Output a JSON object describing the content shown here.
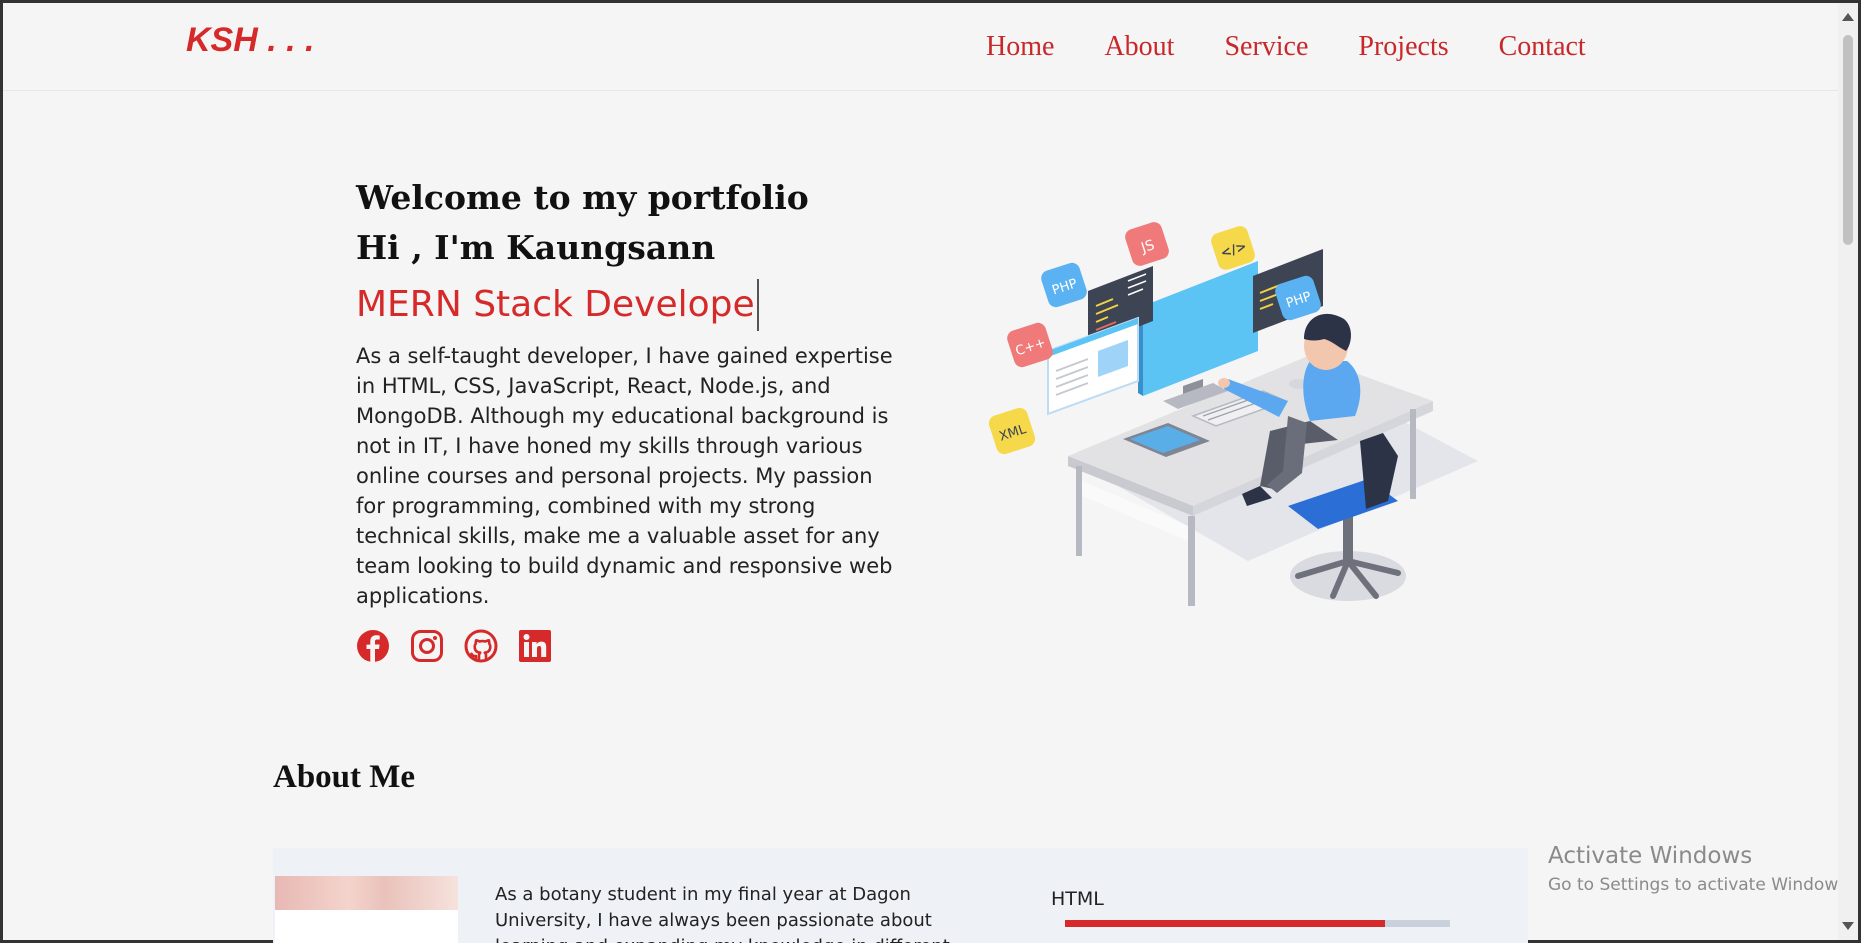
{
  "header": {
    "logo": "KSH . . .",
    "nav": [
      "Home",
      "About",
      "Service",
      "Projects",
      "Contact"
    ]
  },
  "hero": {
    "welcome": "Welcome to my portfolio",
    "greeting": "Hi , I'm Kaungsann",
    "role": "MERN Stack Develope",
    "bio": "As a self-taught developer, I have gained expertise in HTML, CSS, JavaScript, React, Node.js, and MongoDB. Although my educational background is not in IT, I have honed my skills through various online courses and personal projects. My passion for programming, combined with my strong technical skills, make me a valuable asset for any team looking to build dynamic and responsive web applications.",
    "socials": [
      "facebook-icon",
      "instagram-icon",
      "github-icon",
      "linkedin-icon"
    ],
    "illustration_labels": [
      "JS",
      "</>",
      "PHP",
      "PHP",
      "C++",
      "XML"
    ]
  },
  "about": {
    "title": "About Me",
    "text": "As a botany student in my final year at Dagon University, I have always been passionate about learning and expanding my knowledge in different areas. Recently, I",
    "skills": [
      {
        "name": "HTML",
        "level": 0.83
      }
    ]
  },
  "os_overlay": {
    "line1": "Activate Windows",
    "line2": "Go to Settings to activate Windows."
  },
  "colors": {
    "accent": "#d62a2a",
    "background": "#f5f5f5"
  }
}
